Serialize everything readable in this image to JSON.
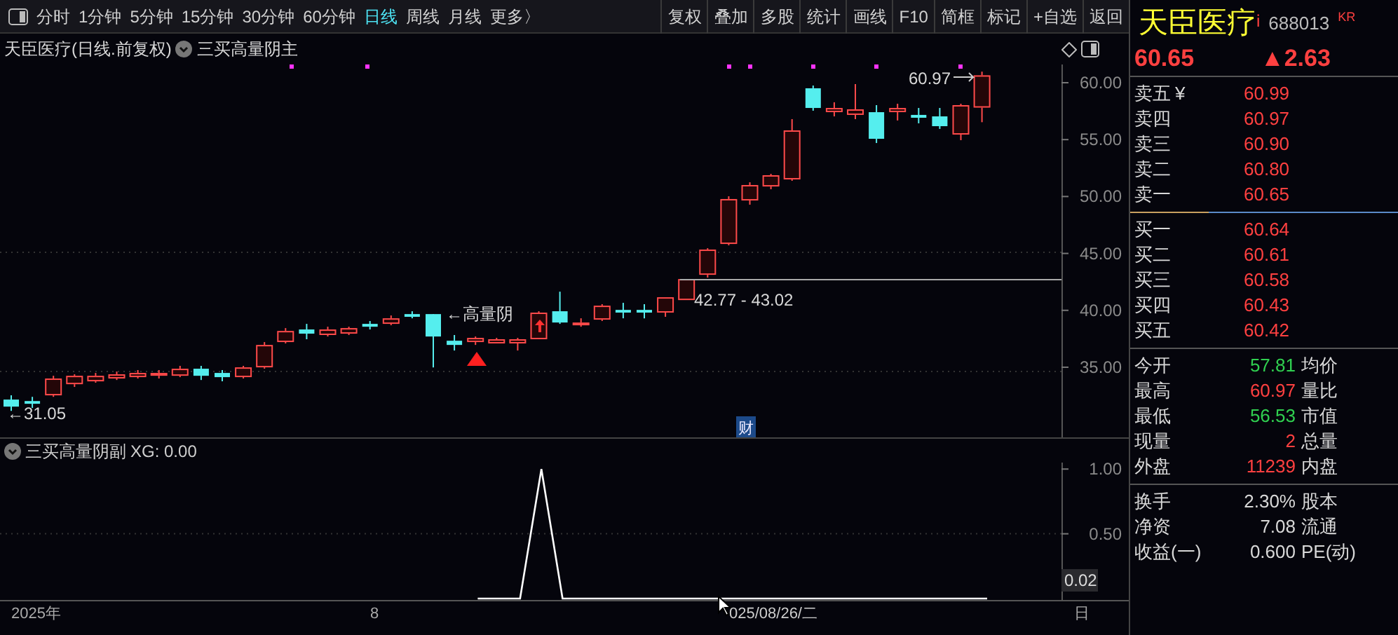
{
  "toolbar": {
    "periods": [
      {
        "label": "分时",
        "selected": false
      },
      {
        "label": "1分钟",
        "selected": false
      },
      {
        "label": "5分钟",
        "selected": false
      },
      {
        "label": "15分钟",
        "selected": false
      },
      {
        "label": "30分钟",
        "selected": false
      },
      {
        "label": "60分钟",
        "selected": false
      },
      {
        "label": "日线",
        "selected": true
      },
      {
        "label": "周线",
        "selected": false
      },
      {
        "label": "月线",
        "selected": false
      }
    ],
    "more": "更多〉",
    "buttons": [
      "复权",
      "叠加",
      "多股",
      "统计",
      "画线",
      "F10",
      "简框",
      "标记",
      "+自选",
      "返回"
    ]
  },
  "chart_header": {
    "title": "天臣医疗(日线.前复权)",
    "indicator": "三买高量阴主"
  },
  "main_chart": {
    "high_label": "60.97",
    "low_label": "←31.05",
    "range_label": "42.77 - 43.02",
    "news_badge": "财",
    "chart_data": {
      "type": "candlestick",
      "ylim": [
        28.84,
        61.6
      ],
      "yticks": [
        {
          "value": 60,
          "label": "60.00"
        },
        {
          "value": 55,
          "label": "55.00"
        },
        {
          "value": 50,
          "label": "50.00"
        },
        {
          "value": 45,
          "label": "45.00"
        },
        {
          "value": 40,
          "label": "40.00"
        },
        {
          "value": 35,
          "label": "35.00"
        }
      ],
      "annotations": [
        "←高量阴"
      ],
      "categories": [
        null,
        null,
        null,
        null,
        null,
        null,
        null,
        null,
        null,
        null,
        null,
        null,
        null,
        null,
        null,
        null,
        null,
        null,
        null,
        null,
        null,
        null,
        null,
        null,
        null,
        null,
        null,
        null,
        null,
        null,
        null,
        null,
        null,
        null,
        null,
        null,
        null,
        null,
        null,
        null,
        null,
        null,
        null,
        null,
        null,
        null,
        null
      ],
      "ohlc": [
        [
          32.16,
          32.53,
          31.17,
          31.54
        ],
        [
          32.03,
          32.4,
          31.42,
          31.79
        ],
        [
          32.53,
          34.25,
          32.4,
          34.01
        ],
        [
          33.51,
          34.38,
          33.27,
          34.25
        ],
        [
          33.76,
          34.5,
          33.64,
          34.25
        ],
        [
          34.01,
          34.62,
          33.88,
          34.38
        ],
        [
          34.13,
          34.75,
          34.01,
          34.5
        ],
        [
          34.25,
          34.75,
          34.01,
          34.5
        ],
        [
          34.25,
          35.12,
          34.13,
          34.87
        ],
        [
          34.87,
          35.12,
          33.88,
          34.25
        ],
        [
          34.5,
          34.75,
          33.76,
          34.13
        ],
        [
          34.13,
          35.12,
          34.01,
          34.99
        ],
        [
          34.99,
          37.21,
          34.87,
          36.96
        ],
        [
          37.21,
          38.44,
          37.09,
          38.19
        ],
        [
          38.32,
          38.81,
          37.46,
          37.95
        ],
        [
          37.83,
          38.56,
          37.7,
          38.32
        ],
        [
          37.95,
          38.56,
          37.83,
          38.44
        ],
        [
          38.81,
          39.06,
          38.32,
          38.56
        ],
        [
          38.81,
          39.55,
          38.69,
          39.3
        ],
        [
          39.67,
          39.92,
          39.3,
          39.43
        ],
        [
          39.67,
          39.67,
          34.99,
          37.7
        ],
        [
          37.33,
          37.83,
          36.47,
          36.96
        ],
        [
          37.21,
          37.7,
          36.96,
          37.58
        ],
        [
          37.09,
          37.58,
          37.09,
          37.46
        ],
        [
          37.09,
          37.58,
          36.47,
          37.46
        ],
        [
          37.46,
          39.92,
          37.46,
          39.8
        ],
        [
          39.92,
          41.64,
          38.81,
          38.93
        ],
        [
          38.81,
          39.3,
          38.56,
          38.93
        ],
        [
          39.18,
          40.54,
          39.06,
          40.41
        ],
        [
          40.04,
          40.66,
          39.3,
          39.8
        ],
        [
          40.04,
          40.54,
          39.3,
          39.8
        ],
        [
          39.8,
          41.15,
          39.43,
          41.15
        ],
        [
          40.9,
          42.75,
          40.9,
          42.75
        ],
        [
          43.12,
          45.46,
          42.88,
          45.34
        ],
        [
          45.83,
          50.02,
          45.71,
          49.78
        ],
        [
          49.65,
          51.25,
          49.28,
          51.01
        ],
        [
          50.88,
          51.99,
          50.64,
          51.87
        ],
        [
          51.5,
          56.8,
          51.38,
          55.81
        ],
        [
          59.51,
          59.75,
          57.54,
          57.78
        ],
        [
          57.41,
          58.28,
          57.04,
          57.78
        ],
        [
          57.17,
          59.88,
          56.8,
          57.66
        ],
        [
          57.41,
          58.03,
          54.7,
          55.07
        ],
        [
          57.41,
          58.15,
          56.68,
          57.78
        ],
        [
          57.17,
          57.78,
          56.43,
          56.92
        ],
        [
          57.04,
          57.78,
          55.94,
          56.18
        ],
        [
          55.44,
          58.15,
          54.95,
          58.03
        ],
        [
          57.81,
          60.97,
          56.53,
          60.65
        ]
      ]
    }
  },
  "indicator_panel": {
    "title": "三买高量阴副",
    "reading": "XG: 0.00",
    "current_value": "0.02",
    "chart_data": {
      "type": "line",
      "categories": [
        null,
        null,
        null,
        null,
        null,
        null,
        null,
        null,
        null,
        null,
        null,
        null,
        null,
        null,
        null,
        null,
        null,
        null,
        null,
        null,
        null,
        null,
        null,
        null,
        null,
        null,
        null,
        null,
        null,
        null,
        null,
        null,
        null,
        null,
        null,
        null,
        null,
        null,
        null,
        null,
        null,
        null,
        null,
        null,
        null,
        null,
        null,
        null,
        null,
        null
      ],
      "ylim": [
        0,
        1.05
      ],
      "yticks": [
        {
          "value": 0.5,
          "label": "0.50"
        },
        {
          "value": 1,
          "label": "1.00"
        }
      ],
      "series": [
        {
          "color": "#ffffff",
          "values": [
            null,
            null,
            null,
            null,
            null,
            null,
            null,
            null,
            null,
            null,
            null,
            null,
            null,
            null,
            null,
            null,
            null,
            null,
            null,
            null,
            null,
            null,
            0,
            0,
            0,
            1,
            0,
            0,
            0,
            0,
            0,
            0,
            0,
            0,
            0,
            0,
            0,
            0,
            0,
            0,
            0,
            0,
            0,
            0,
            0,
            0,
            0,
            null,
            null,
            null
          ]
        }
      ]
    }
  },
  "time_axis": {
    "labels": [
      "2025年",
      "8"
    ],
    "cursor_date": "025/08/26/二",
    "period": "日"
  },
  "quote": {
    "name": "天臣医疗",
    "info_mark": "i",
    "code": "688013",
    "tag": "KR",
    "price": "60.65",
    "change": "▲2.63"
  },
  "order_book": [
    {
      "label": "卖五",
      "suffix": "¥",
      "price": "60.99",
      "kind": "ask"
    },
    {
      "label": "卖四",
      "price": "60.97",
      "kind": "ask"
    },
    {
      "label": "卖三",
      "price": "60.90",
      "kind": "ask"
    },
    {
      "label": "卖二",
      "price": "60.80",
      "kind": "ask"
    },
    {
      "label": "卖一",
      "price": "60.65",
      "kind": "ask"
    },
    {
      "label": "买一",
      "price": "60.64",
      "kind": "bid"
    },
    {
      "label": "买二",
      "price": "60.61",
      "kind": "bid"
    },
    {
      "label": "买三",
      "price": "60.58",
      "kind": "bid"
    },
    {
      "label": "买四",
      "price": "60.43",
      "kind": "bid"
    },
    {
      "label": "买五",
      "price": "60.42",
      "kind": "bid"
    }
  ],
  "stats": [
    {
      "label": "今开",
      "value": "57.81",
      "color": "#30d050",
      "label2": "均价"
    },
    {
      "label": "最高",
      "value": "60.97",
      "color": "#ff4040",
      "label2": "量比"
    },
    {
      "label": "最低",
      "value": "56.53",
      "color": "#30d050",
      "label2": "市值"
    },
    {
      "label": "现量",
      "value": "2",
      "color": "#ff4040",
      "label2": "总量"
    },
    {
      "label": "外盘",
      "value": "11239",
      "color": "#ff4040",
      "label2": "内盘"
    }
  ],
  "fundamentals": [
    {
      "label": "换手",
      "value": "2.30%",
      "label2": "股本"
    },
    {
      "label": "净资",
      "value": "7.08",
      "label2": "流通"
    },
    {
      "label": "收益(一)",
      "value": "0.600",
      "label2": "PE(动)"
    }
  ]
}
